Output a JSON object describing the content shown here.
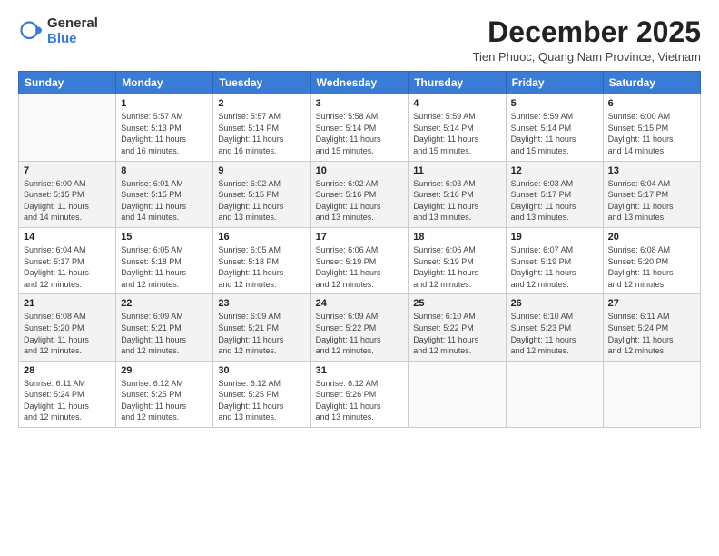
{
  "logo": {
    "general": "General",
    "blue": "Blue"
  },
  "header": {
    "month": "December 2025",
    "location": "Tien Phuoc, Quang Nam Province, Vietnam"
  },
  "weekdays": [
    "Sunday",
    "Monday",
    "Tuesday",
    "Wednesday",
    "Thursday",
    "Friday",
    "Saturday"
  ],
  "weeks": [
    [
      {
        "day": "",
        "info": ""
      },
      {
        "day": "1",
        "info": "Sunrise: 5:57 AM\nSunset: 5:13 PM\nDaylight: 11 hours\nand 16 minutes."
      },
      {
        "day": "2",
        "info": "Sunrise: 5:57 AM\nSunset: 5:14 PM\nDaylight: 11 hours\nand 16 minutes."
      },
      {
        "day": "3",
        "info": "Sunrise: 5:58 AM\nSunset: 5:14 PM\nDaylight: 11 hours\nand 15 minutes."
      },
      {
        "day": "4",
        "info": "Sunrise: 5:59 AM\nSunset: 5:14 PM\nDaylight: 11 hours\nand 15 minutes."
      },
      {
        "day": "5",
        "info": "Sunrise: 5:59 AM\nSunset: 5:14 PM\nDaylight: 11 hours\nand 15 minutes."
      },
      {
        "day": "6",
        "info": "Sunrise: 6:00 AM\nSunset: 5:15 PM\nDaylight: 11 hours\nand 14 minutes."
      }
    ],
    [
      {
        "day": "7",
        "info": "Sunrise: 6:00 AM\nSunset: 5:15 PM\nDaylight: 11 hours\nand 14 minutes."
      },
      {
        "day": "8",
        "info": "Sunrise: 6:01 AM\nSunset: 5:15 PM\nDaylight: 11 hours\nand 14 minutes."
      },
      {
        "day": "9",
        "info": "Sunrise: 6:02 AM\nSunset: 5:15 PM\nDaylight: 11 hours\nand 13 minutes."
      },
      {
        "day": "10",
        "info": "Sunrise: 6:02 AM\nSunset: 5:16 PM\nDaylight: 11 hours\nand 13 minutes."
      },
      {
        "day": "11",
        "info": "Sunrise: 6:03 AM\nSunset: 5:16 PM\nDaylight: 11 hours\nand 13 minutes."
      },
      {
        "day": "12",
        "info": "Sunrise: 6:03 AM\nSunset: 5:17 PM\nDaylight: 11 hours\nand 13 minutes."
      },
      {
        "day": "13",
        "info": "Sunrise: 6:04 AM\nSunset: 5:17 PM\nDaylight: 11 hours\nand 13 minutes."
      }
    ],
    [
      {
        "day": "14",
        "info": "Sunrise: 6:04 AM\nSunset: 5:17 PM\nDaylight: 11 hours\nand 12 minutes."
      },
      {
        "day": "15",
        "info": "Sunrise: 6:05 AM\nSunset: 5:18 PM\nDaylight: 11 hours\nand 12 minutes."
      },
      {
        "day": "16",
        "info": "Sunrise: 6:05 AM\nSunset: 5:18 PM\nDaylight: 11 hours\nand 12 minutes."
      },
      {
        "day": "17",
        "info": "Sunrise: 6:06 AM\nSunset: 5:19 PM\nDaylight: 11 hours\nand 12 minutes."
      },
      {
        "day": "18",
        "info": "Sunrise: 6:06 AM\nSunset: 5:19 PM\nDaylight: 11 hours\nand 12 minutes."
      },
      {
        "day": "19",
        "info": "Sunrise: 6:07 AM\nSunset: 5:19 PM\nDaylight: 11 hours\nand 12 minutes."
      },
      {
        "day": "20",
        "info": "Sunrise: 6:08 AM\nSunset: 5:20 PM\nDaylight: 11 hours\nand 12 minutes."
      }
    ],
    [
      {
        "day": "21",
        "info": "Sunrise: 6:08 AM\nSunset: 5:20 PM\nDaylight: 11 hours\nand 12 minutes."
      },
      {
        "day": "22",
        "info": "Sunrise: 6:09 AM\nSunset: 5:21 PM\nDaylight: 11 hours\nand 12 minutes."
      },
      {
        "day": "23",
        "info": "Sunrise: 6:09 AM\nSunset: 5:21 PM\nDaylight: 11 hours\nand 12 minutes."
      },
      {
        "day": "24",
        "info": "Sunrise: 6:09 AM\nSunset: 5:22 PM\nDaylight: 11 hours\nand 12 minutes."
      },
      {
        "day": "25",
        "info": "Sunrise: 6:10 AM\nSunset: 5:22 PM\nDaylight: 11 hours\nand 12 minutes."
      },
      {
        "day": "26",
        "info": "Sunrise: 6:10 AM\nSunset: 5:23 PM\nDaylight: 11 hours\nand 12 minutes."
      },
      {
        "day": "27",
        "info": "Sunrise: 6:11 AM\nSunset: 5:24 PM\nDaylight: 11 hours\nand 12 minutes."
      }
    ],
    [
      {
        "day": "28",
        "info": "Sunrise: 6:11 AM\nSunset: 5:24 PM\nDaylight: 11 hours\nand 12 minutes."
      },
      {
        "day": "29",
        "info": "Sunrise: 6:12 AM\nSunset: 5:25 PM\nDaylight: 11 hours\nand 12 minutes."
      },
      {
        "day": "30",
        "info": "Sunrise: 6:12 AM\nSunset: 5:25 PM\nDaylight: 11 hours\nand 13 minutes."
      },
      {
        "day": "31",
        "info": "Sunrise: 6:12 AM\nSunset: 5:26 PM\nDaylight: 11 hours\nand 13 minutes."
      },
      {
        "day": "",
        "info": ""
      },
      {
        "day": "",
        "info": ""
      },
      {
        "day": "",
        "info": ""
      }
    ]
  ]
}
